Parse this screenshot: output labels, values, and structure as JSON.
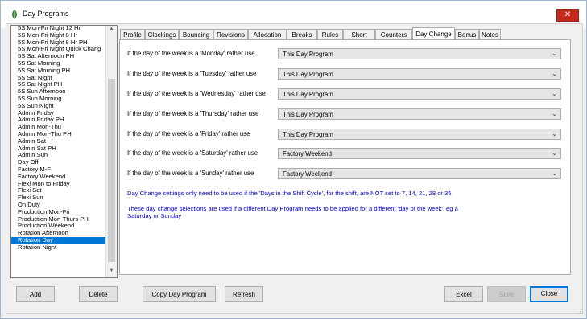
{
  "window": {
    "title": "Day Programs",
    "close_glyph": "✕"
  },
  "list": {
    "items": [
      "5S Mon-Fri Night 12 Hr",
      "5S Mon-Fri Night 8 Hr",
      "5S Mon-Fri Night 8 Hr PH",
      "5S Mon-Fri Night Quick Chang",
      "5S Sat Afternoon PH",
      "5S Sat Morning",
      "5S Sat Morning PH",
      "5S Sat Night",
      "5S Sat Night PH",
      "5S Sun Afternoon",
      "5S Sun Morning",
      "5S Sun Night",
      "Admin Friday",
      "Admin Friday PH",
      "Admin Mon-Thu",
      "Admin Mon-Thu PH",
      "Admin Sat",
      "Admin Sat PH",
      "Admin Sun",
      "Day Off",
      "Factory M-F",
      "Factory Weekend",
      "Flexi Mon to Friday",
      "Flexi Sat",
      "Flexi Sun",
      "On Duty",
      "Production Mon-Fri",
      "Production Mon-Thurs PH",
      "Production Weekend",
      "Rotation Afternoon",
      "Rotation Day",
      "Rotation Night"
    ],
    "selected": "Rotation Day"
  },
  "tabs": [
    "Profile",
    "Clockings",
    "Bouncing",
    "Revisions",
    "Allocation",
    "Breaks",
    "Rules",
    "Short Time",
    "Counters",
    "Day Change",
    "Bonus",
    "Notes"
  ],
  "active_tab": "Day Change",
  "rows": [
    {
      "label": "If the day of the week is a 'Monday' rather use",
      "value": "This Day Program"
    },
    {
      "label": "If the day of the week is a 'Tuesday' rather use",
      "value": "This Day Program"
    },
    {
      "label": "If the day of the week is a 'Wednesday' rather use",
      "value": "This Day Program"
    },
    {
      "label": "If the day of the week is a 'Thursday' rather use",
      "value": "This Day Program"
    },
    {
      "label": "If the day of the week is a 'Friday' rather use",
      "value": "This Day Program"
    },
    {
      "label": "If the day of the week is a 'Saturday' rather use",
      "value": "Factory Weekend"
    },
    {
      "label": "If the day of the week is a 'Sunday' rather use",
      "value": "Factory Weekend"
    }
  ],
  "notes": {
    "note1": "Day Change settings only need to be used if the 'Days in the Shift Cycle', for the shift, are NOT set to 7, 14, 21, 28 or 35",
    "note2a": "These day change selections are used if a different Day Program needs to be applied for a different 'day of the week', eg a",
    "note2b": "Saturday or Sunday"
  },
  "buttons": {
    "add": "Add",
    "delete": "Delete",
    "copy": "Copy Day Program",
    "refresh": "Refresh",
    "excel": "Excel",
    "save": "Save",
    "close": "Close"
  },
  "colors": {
    "selection": "#0078d7",
    "note_text": "#0000cc",
    "close_button": "#c42b1c"
  }
}
